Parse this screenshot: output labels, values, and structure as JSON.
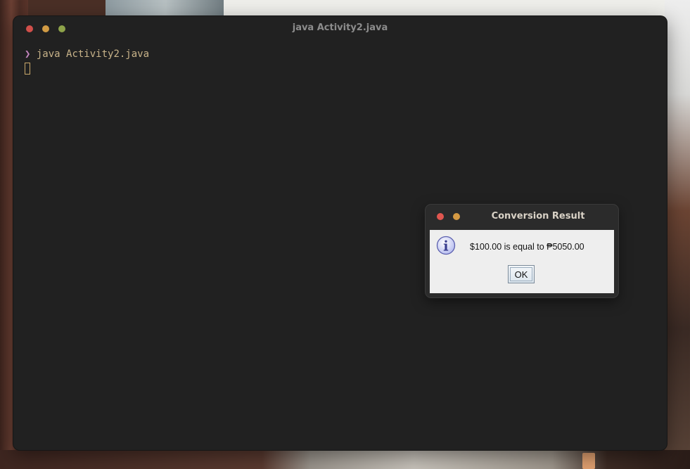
{
  "terminal": {
    "title": "java Activity2.java",
    "prompt_symbol": "❯",
    "command": "java Activity2.java"
  },
  "dialog": {
    "title": "Conversion Result",
    "message": "$100.00 is equal to ₱5050.00",
    "ok_label": "OK",
    "icon": "info-icon"
  },
  "colors": {
    "terminal_bg": "#212121",
    "prompt": "#c586c0",
    "command_text": "#c9b48a",
    "dialog_bg": "#eeeeee"
  }
}
